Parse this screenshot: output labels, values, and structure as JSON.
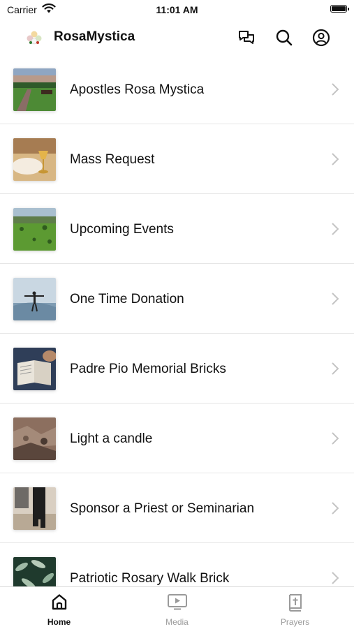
{
  "status_bar": {
    "carrier": "Carrier",
    "time": "11:01 AM"
  },
  "header": {
    "title": "RosaMystica",
    "icons": [
      "chat-icon",
      "search-icon",
      "profile-icon"
    ]
  },
  "list": {
    "items": [
      {
        "label": "Apostles Rosa Mystica",
        "thumbnail": "garden-path-photo"
      },
      {
        "label": "Mass Request",
        "thumbnail": "chalice-photo"
      },
      {
        "label": "Upcoming Events",
        "thumbnail": "green-field-photo"
      },
      {
        "label": "One Time Donation",
        "thumbnail": "person-arms-open-photo"
      },
      {
        "label": "Padre Pio Memorial Bricks",
        "thumbnail": "open-book-photo"
      },
      {
        "label": "Light a candle",
        "thumbnail": "rocky-landscape-photo"
      },
      {
        "label": "Sponsor a Priest or Seminarian",
        "thumbnail": "priest-walking-photo"
      },
      {
        "label": "Patriotic Rosary Walk Brick",
        "thumbnail": "leaves-photo"
      }
    ]
  },
  "tab_bar": {
    "tabs": [
      {
        "label": "Home",
        "icon": "home-icon",
        "active": true
      },
      {
        "label": "Media",
        "icon": "media-icon",
        "active": false
      },
      {
        "label": "Prayers",
        "icon": "prayer-book-icon",
        "active": false
      }
    ]
  },
  "colors": {
    "accent": "#111111",
    "inactive_tab": "#9a9a9a",
    "separator": "#e6e6e6"
  }
}
